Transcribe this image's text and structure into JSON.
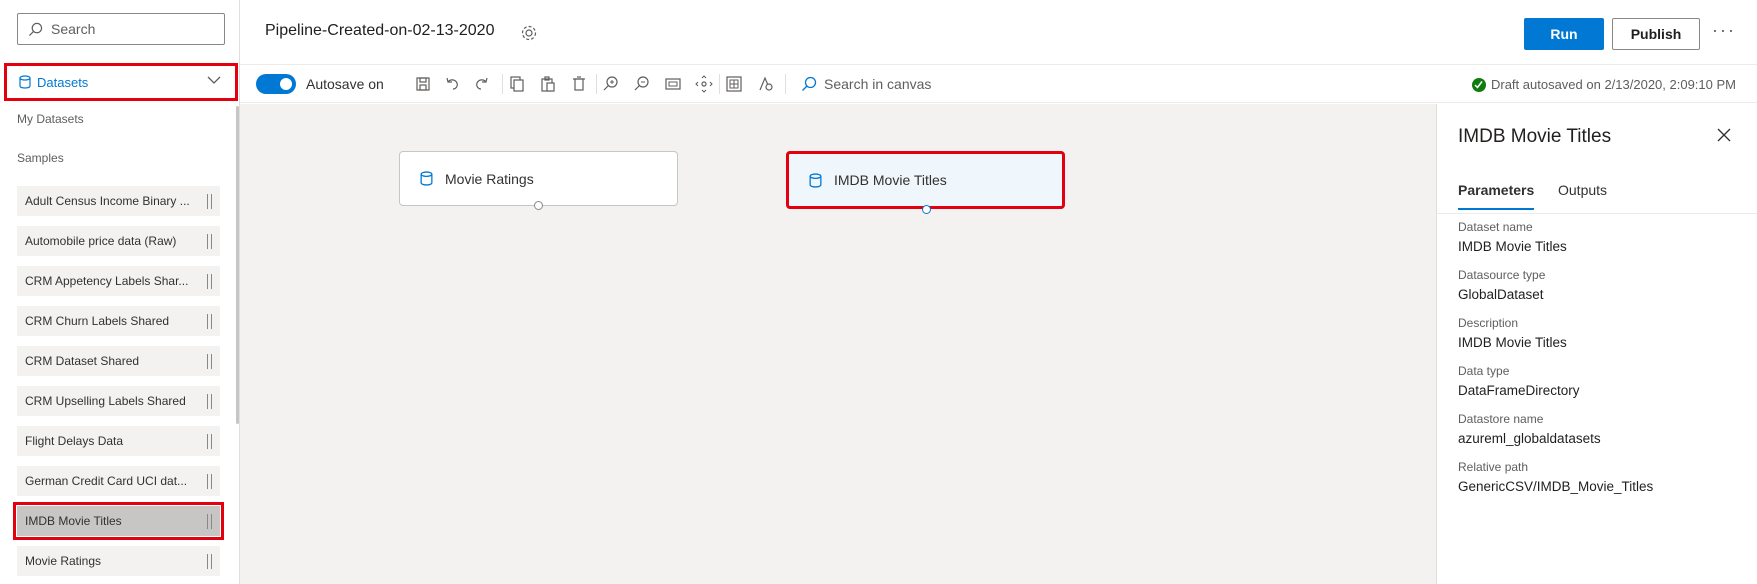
{
  "left_panel": {
    "search_placeholder": "Search",
    "section_header": "Datasets",
    "my_datasets_label": "My Datasets",
    "samples_label": "Samples",
    "items": [
      {
        "label": "Adult Census Income Binary ..."
      },
      {
        "label": "Automobile price data (Raw)"
      },
      {
        "label": "CRM Appetency Labels Shar..."
      },
      {
        "label": "CRM Churn Labels Shared"
      },
      {
        "label": "CRM Dataset Shared"
      },
      {
        "label": "CRM Upselling Labels Shared"
      },
      {
        "label": "Flight Delays Data"
      },
      {
        "label": "German Credit Card UCI dat..."
      },
      {
        "label": "IMDB Movie Titles"
      },
      {
        "label": "Movie Ratings"
      }
    ],
    "selected_item": "IMDB Movie Titles"
  },
  "header": {
    "pipeline_title": "Pipeline-Created-on-02-13-2020",
    "run_label": "Run",
    "publish_label": "Publish",
    "more_label": "···"
  },
  "toolbar": {
    "autosave_label": "Autosave on",
    "autosave_on": true,
    "search_canvas_placeholder": "Search in canvas",
    "draft_status": "Draft autosaved on 2/13/2020, 2:09:10 PM"
  },
  "canvas": {
    "nodes": [
      {
        "label": "Movie Ratings"
      },
      {
        "label": "IMDB Movie Titles"
      }
    ]
  },
  "right_panel": {
    "title": "IMDB Movie Titles",
    "tabs": [
      "Parameters",
      "Outputs"
    ],
    "active_tab": "Parameters",
    "params": [
      {
        "label": "Dataset name",
        "value": "IMDB Movie Titles"
      },
      {
        "label": "Datasource type",
        "value": "GlobalDataset"
      },
      {
        "label": "Description",
        "value": "IMDB Movie Titles"
      },
      {
        "label": "Data type",
        "value": "DataFrameDirectory"
      },
      {
        "label": "Datastore name",
        "value": "azureml_globaldatasets"
      },
      {
        "label": "Relative path",
        "value": "GenericCSV/IMDB_Movie_Titles"
      }
    ]
  },
  "colors": {
    "accent": "#0078d4",
    "highlight_box": "#e3000f",
    "success": "#107c10"
  }
}
